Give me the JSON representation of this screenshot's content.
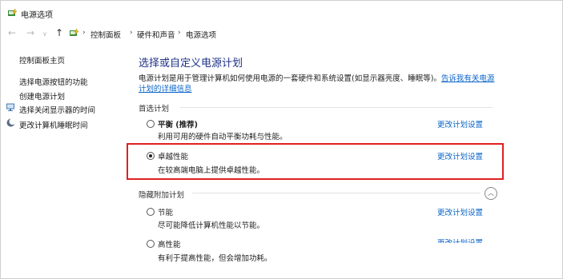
{
  "window": {
    "title": "电源选项",
    "icon": "power-options-icon"
  },
  "nav": {
    "back": "←",
    "forward": "→",
    "down": "∨",
    "up": "↑",
    "breadcrumb": [
      "控制面板",
      "硬件和声音",
      "电源选项"
    ],
    "separator": "›"
  },
  "sidebar": {
    "items": [
      {
        "label": "控制面板主页"
      },
      {
        "label": "选择电源按钮的功能"
      },
      {
        "label": "创建电源计划"
      },
      {
        "label": "选择关闭显示器的时间",
        "icon": "display-shield-icon"
      },
      {
        "label": "更改计算机睡眠时间",
        "icon": "moon-icon"
      }
    ]
  },
  "main": {
    "heading": "选择或自定义电源计划",
    "description": "电源计划是用于管理计算机如何使用电源的一套硬件和系统设置(如显示器亮度、睡眠等)。",
    "description_link": "告诉我有关电源计划的详细信息",
    "preferred_section": "首选计划",
    "hidden_section": "隐藏附加计划",
    "collapse_icon": "︿",
    "change_link": "更改计划设置",
    "preferred_plans": [
      {
        "name": "平衡 (推荐)",
        "desc": "利用可用的硬件自动平衡功耗与性能。",
        "selected": false
      },
      {
        "name": "卓越性能",
        "desc": "在较高端电脑上提供卓越性能。",
        "selected": true
      }
    ],
    "hidden_plans": [
      {
        "name": "节能",
        "desc": "尽可能降低计算机性能以节能。",
        "selected": false
      },
      {
        "name": "高性能",
        "desc": "有利于提高性能，但会增加功耗。",
        "selected": false
      }
    ]
  },
  "colors": {
    "heading": "#1e3287",
    "link": "#0b65c8",
    "highlight": "#e02020"
  }
}
